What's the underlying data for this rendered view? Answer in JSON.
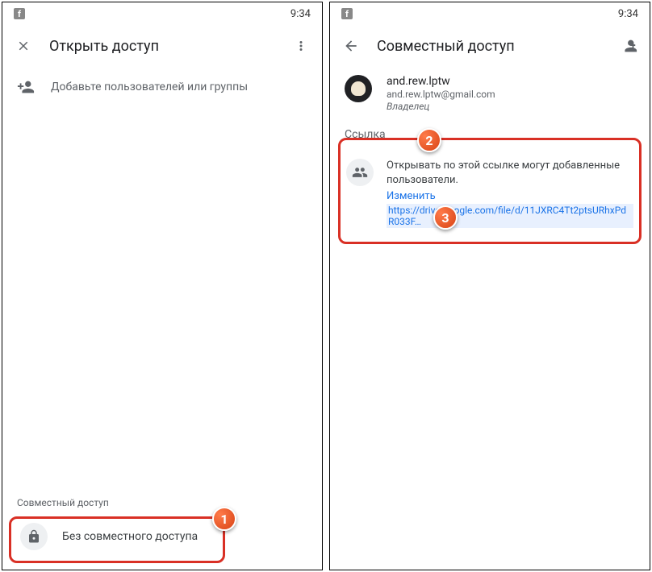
{
  "status": {
    "time": "9:34"
  },
  "left": {
    "title": "Открыть доступ",
    "add_users_label": "Добавьте пользователей или группы",
    "bottom_label": "Совместный доступ",
    "no_share_label": "Без совместного доступа"
  },
  "right": {
    "title": "Совместный доступ",
    "user": {
      "name": "and.rew.lptw",
      "email": "and.rew.lptw@gmail.com",
      "role": "Владелец"
    },
    "section_label": "Ссылка",
    "link_desc": "Открывать по этой ссылке могут добавленные пользователи.",
    "change_label": "Изменить",
    "url": "https://drive.google.com/file/d/11JXRC4Tt2ptsURhxPdR033F…"
  },
  "badges": {
    "b1": "1",
    "b2": "2",
    "b3": "3"
  }
}
